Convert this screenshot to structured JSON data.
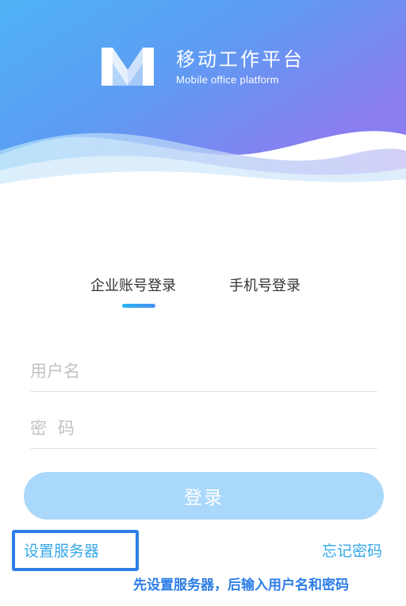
{
  "brand": {
    "title": "移动工作平台",
    "subtitle": "Mobile office platform",
    "logo_icon": "m-logo-icon"
  },
  "tabs": [
    {
      "label": "企业账号登录",
      "active": true
    },
    {
      "label": "手机号登录",
      "active": false
    }
  ],
  "form": {
    "username_placeholder": "用户名",
    "username_value": "",
    "password_placeholder": "密码",
    "password_value": ""
  },
  "login_button": {
    "label": "登录"
  },
  "links": {
    "server_settings": "设置服务器",
    "forgot_password": "忘记密码"
  },
  "annotation": {
    "text": "先设置服务器，后输入用户名和密码"
  },
  "colors": {
    "gradient_start": "#4fb3f5",
    "gradient_end": "#8a7df0",
    "accent": "#35a8e8",
    "button_bg": "#a9d8fa",
    "highlight_box": "#2d7ee6"
  }
}
